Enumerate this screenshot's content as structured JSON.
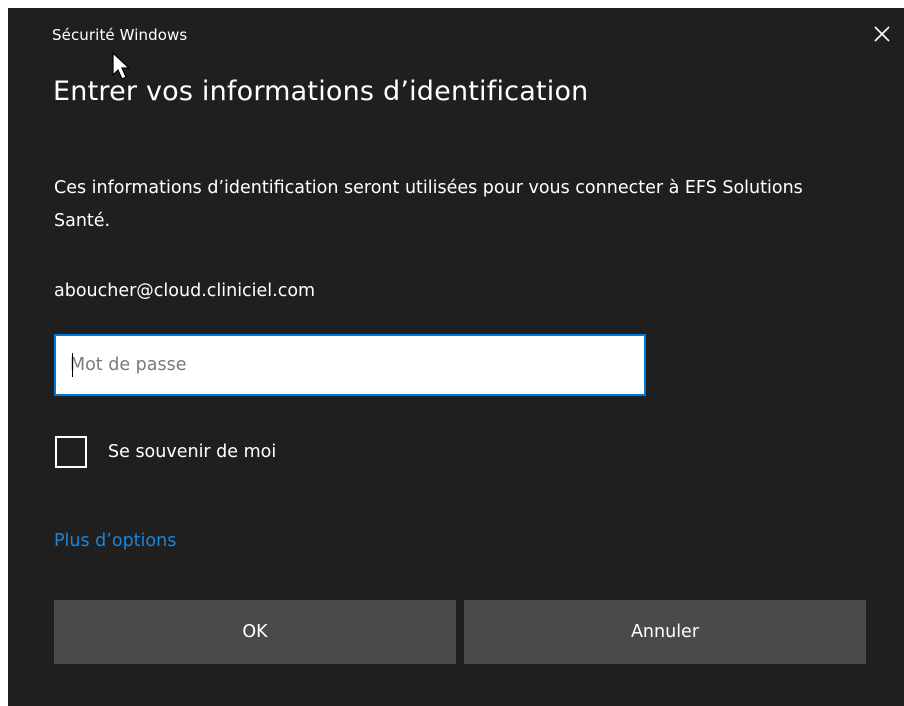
{
  "window": {
    "title": "Sécurité Windows"
  },
  "dialog": {
    "heading": "Entrer vos informations d’identification",
    "description": "Ces informations d’identification seront utilisées pour vous connecter à EFS Solutions Santé.",
    "account": "aboucher@cloud.cliniciel.com",
    "password": {
      "value": "",
      "placeholder": "Mot de passe"
    },
    "remember_me": {
      "label": "Se souvenir de moi",
      "checked": false
    },
    "more_options_label": "Plus d’options"
  },
  "buttons": {
    "ok_label": "OK",
    "cancel_label": "Annuler"
  },
  "icons": {
    "close": "close-icon",
    "cursor": "mouse-pointer-icon"
  },
  "colors": {
    "background": "#1f1f1f",
    "accent": "#0078d7",
    "link": "#1a86d8",
    "button": "#4a4a4a"
  }
}
